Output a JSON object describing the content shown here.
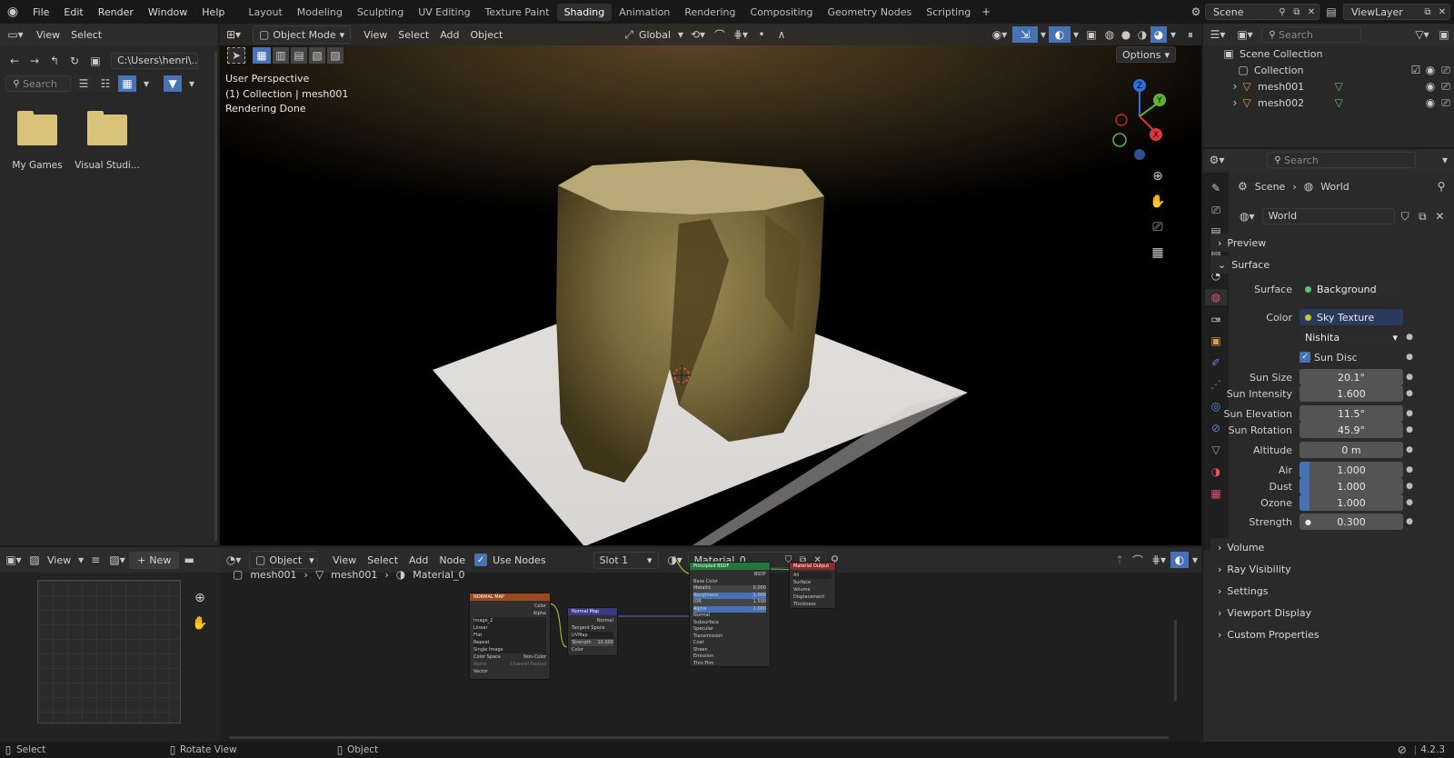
{
  "app": {
    "menus": [
      "File",
      "Edit",
      "Render",
      "Window",
      "Help"
    ],
    "workspaces": [
      "Layout",
      "Modeling",
      "Sculpting",
      "UV Editing",
      "Texture Paint",
      "Shading",
      "Animation",
      "Rendering",
      "Compositing",
      "Geometry Nodes",
      "Scripting"
    ],
    "active_workspace": "Shading",
    "scene": "Scene",
    "view_layer": "ViewLayer"
  },
  "file_browser": {
    "menu": [
      "View",
      "Select"
    ],
    "path": "C:\\Users\\henri\\...",
    "search_placeholder": "Search",
    "items": [
      {
        "label": "My Games"
      },
      {
        "label": "Visual Studi..."
      }
    ]
  },
  "viewport": {
    "mode": "Object Mode",
    "menus": [
      "View",
      "Select",
      "Add",
      "Object"
    ],
    "orientation": "Global",
    "info_lines": [
      "User Perspective",
      "(1) Collection | mesh001",
      "Rendering Done"
    ],
    "options_label": "Options",
    "gizmo_axes": [
      "Z",
      "Y",
      "X"
    ]
  },
  "image_editor": {
    "view_label": "View",
    "new_label": "New"
  },
  "node_editor": {
    "type": "Object",
    "menus": [
      "View",
      "Select",
      "Add",
      "Node"
    ],
    "use_nodes_label": "Use Nodes",
    "use_nodes": true,
    "slot": "Slot 1",
    "material": "Material_0",
    "breadcrumb": [
      "mesh001",
      "mesh001",
      "Material_0"
    ],
    "nodes": {
      "normal_map_tex": {
        "title": "NORMAL MAP",
        "rows": [
          "Color",
          "Alpha",
          "Image_2",
          "Linear",
          "Flat",
          "Repeat",
          "Single Image",
          "Color Space",
          "Non-Color",
          "Alpha",
          "Channel Packed",
          "Vector"
        ]
      },
      "normal_map": {
        "title": "Normal Map",
        "rows": [
          "Normal",
          "Tangent Space",
          "UVMap",
          "Strength",
          "10.000",
          "Color"
        ]
      },
      "bsdf": {
        "title": "Principled BSDF",
        "rows": [
          "BSDF",
          "Base Color",
          "Metallic",
          "0.000",
          "Roughness",
          "1.000",
          "IOR",
          "1.500",
          "Alpha",
          "1.000",
          "Normal",
          "Subsurface",
          "Specular",
          "Transmission",
          "Coat",
          "Sheen",
          "Emission",
          "Thin Film"
        ]
      },
      "output": {
        "title": "Material Output",
        "rows": [
          "All",
          "Surface",
          "Volume",
          "Displacement",
          "Thickness"
        ]
      }
    }
  },
  "outliner": {
    "search_placeholder": "Search",
    "items": [
      {
        "label": "Scene Collection"
      },
      {
        "label": "Collection"
      },
      {
        "label": "mesh001"
      },
      {
        "label": "mesh002"
      }
    ]
  },
  "properties": {
    "search_placeholder": "Search",
    "breadcrumb": [
      "Scene",
      "World"
    ],
    "world_name": "World",
    "sections": {
      "preview": "Preview",
      "surface": "Surface",
      "volume": "Volume",
      "ray_visibility": "Ray Visibility",
      "settings": "Settings",
      "viewport_display": "Viewport Display",
      "custom_properties": "Custom Properties"
    },
    "surface_label": "Surface",
    "surface_value": "Background",
    "color_label": "Color",
    "color_value": "Sky Texture",
    "sky_type": "Nishita",
    "sun_disc_label": "Sun Disc",
    "sun_disc": true,
    "fields": [
      {
        "label": "Sun Size",
        "value": "20.1°",
        "fill": 0
      },
      {
        "label": "Sun Intensity",
        "value": "1.600",
        "fill": 0
      },
      {
        "label": "Sun Elevation",
        "value": "11.5°",
        "fill": 0
      },
      {
        "label": "Sun Rotation",
        "value": "45.9°",
        "fill": 0
      },
      {
        "label": "Altitude",
        "value": "0 m",
        "fill": 0
      },
      {
        "label": "Air",
        "value": "1.000",
        "fill": 0.1
      },
      {
        "label": "Dust",
        "value": "1.000",
        "fill": 0.1
      },
      {
        "label": "Ozone",
        "value": "1.000",
        "fill": 0.1
      }
    ],
    "strength_label": "Strength",
    "strength_value": "0.300"
  },
  "statusbar": {
    "select": "Select",
    "rotate_view": "Rotate View",
    "object": "Object",
    "version": "4.2.3"
  }
}
